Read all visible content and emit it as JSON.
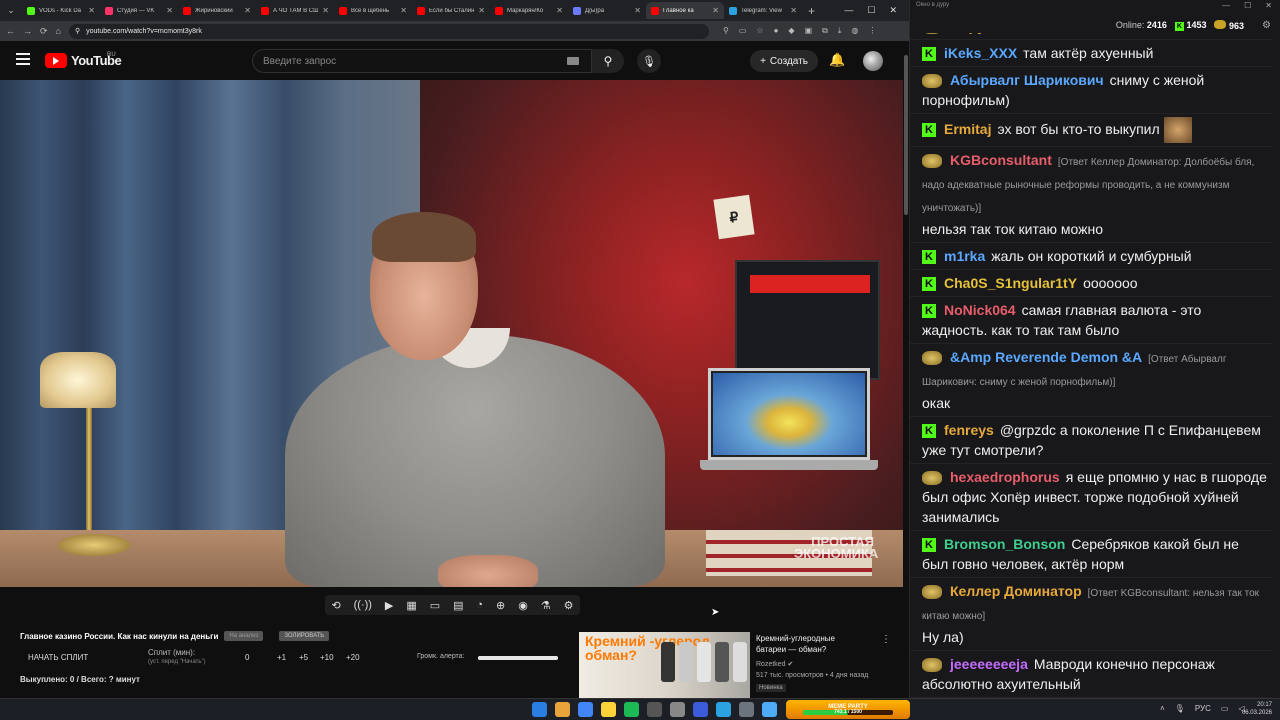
{
  "browser": {
    "tabs": [
      {
        "title": "VODs - Kick Da",
        "color": "#53fc18"
      },
      {
        "title": "Студия — VK",
        "color": "#ff3366"
      },
      {
        "title": "Жириновский",
        "color": "#ff0000"
      },
      {
        "title": "А ЧО ТАМ В СШ",
        "color": "#ff0000"
      },
      {
        "title": "Все в щебень",
        "color": "#ff0000"
      },
      {
        "title": "Если бы Сталин",
        "color": "#ff0000"
      },
      {
        "title": "Маркарян/Ко",
        "color": "#ff0000"
      },
      {
        "title": "Д(ы)ра",
        "color": "#6b7bff"
      },
      {
        "title": "Главное ка",
        "color": "#ff0000",
        "active": true
      },
      {
        "title": "Telegram: View",
        "color": "#2aa3e0"
      }
    ],
    "url": "youtube.com/watch?v=mcmomt3y8rk"
  },
  "youtube": {
    "logo": "YouTube",
    "region": "RU",
    "search_placeholder": "Введите запрос",
    "create_label": "Создать"
  },
  "video": {
    "paper_symbol": "₽",
    "watermark": "ПРОСТАЯ ЭКОНОМИКА"
  },
  "tools": [
    "⟲",
    "((·))",
    "▶",
    "▦",
    "▭",
    "▤",
    "◔",
    "⊕",
    "◉",
    "⚗",
    "⚙"
  ],
  "below": {
    "title": "Главное казино России. Как нас кинули на деньги",
    "tag1": "На анализ",
    "tag2": "ЗОЛИРОВАТЬ",
    "split_button": "НАЧАТЬ СПЛИТ",
    "split_label": "Сплит (мин):",
    "split_hint": "(уст. перед \"Начать\")",
    "split_values": [
      "0",
      "+1",
      "+5",
      "+10",
      "+20"
    ],
    "alert_volume_label": "Громк. алерта:",
    "alert_volume": 1.0,
    "bought": "Выкуплено: 0 / Всего: ? минут"
  },
  "recommended": {
    "thumb_text": "Кремний -углерод обман?",
    "title": "Кремний-углеродные батареи — обман?",
    "channel": "Rozetked",
    "meta": "517 тыс. просмотров • 4 дня назад",
    "badge": "Новинка"
  },
  "chat": {
    "window_title": "Окно в дуру",
    "online_label": "Online:",
    "online": "2416",
    "kick_count": "1453",
    "other_count": "963",
    "messages": [
      {
        "badge": "p",
        "user": "CopyPaste",
        "color": "#e6a93a",
        "reply": "",
        "text": "ген П имба"
      },
      {
        "badge": "k",
        "user": "iKeks_XXX",
        "color": "#5aa8ff",
        "reply": "",
        "text": "там актёр ахуенный"
      },
      {
        "badge": "p",
        "user": "Абырвалг Шарикович",
        "color": "#5aa8ff",
        "reply": "",
        "text": "сниму с женой порнофильм)"
      },
      {
        "badge": "k",
        "user": "Ermitaj",
        "color": "#e6a93a",
        "reply": "",
        "text": "эх вот бы кто-то выкупил",
        "emote": true
      },
      {
        "badge": "p",
        "user": "KGBconsultant",
        "color": "#e85d6a",
        "reply": "[Ответ Келлер Доминатор: Долбоёбы бля, надо адекватные рыночные реформы проводить, а не коммунизм уничтожать)]",
        "text": "нельзя так ток китаю можно"
      },
      {
        "badge": "k",
        "user": "m1rka",
        "color": "#5aa8ff",
        "reply": "",
        "text": "жаль он короткий и сумбурный"
      },
      {
        "badge": "k",
        "user": "Cha0S_S1ngular1tY",
        "color": "#e6c13a",
        "reply": "",
        "text": "ooooooo"
      },
      {
        "badge": "k",
        "user": "NoNick064",
        "color": "#e85d6a",
        "reply": "",
        "text": "самая главная валюта - это жадность. как то так там было"
      },
      {
        "badge": "p",
        "user": "&Amp Reverende Demon &A",
        "color": "#5aa8ff",
        "reply": "[Ответ Абырвалг Шарикович: сниму с женой порнофильм)]",
        "text": "окак"
      },
      {
        "badge": "k",
        "user": "fenreys",
        "color": "#e6a93a",
        "reply": "",
        "text": "@grpzdc а поколение П с Епифанцевем уже тут смотрели?"
      },
      {
        "badge": "p",
        "user": "hexaedrophorus",
        "color": "#e85d6a",
        "reply": "",
        "text": "я еще рпомню у нас в гшороде был офис Хопёр инвест. торже подобной хуйней занимались"
      },
      {
        "badge": "k",
        "user": "Bromson_Bonson",
        "color": "#3ecf8e",
        "reply": "",
        "text": "Серебряков какой был не был говно человек, актёр норм"
      },
      {
        "badge": "p",
        "user": "Келлер Доминатор",
        "color": "#e6a93a",
        "reply": "[Ответ KGBconsultant: нельзя так ток китаю можно]",
        "text": "Ну ла)"
      },
      {
        "badge": "p",
        "user": "jeeeeeeeeja",
        "color": "#c46cff",
        "reply": "",
        "text": "Мавроди конечно персонаж абсолютно ахуительный"
      }
    ]
  },
  "taskbar": {
    "meme_label": "MEME PARTY",
    "meme_progress_text": "743.1 / 1500",
    "meme_progress": 0.495,
    "lang": "РУС",
    "time": "20:17",
    "date": "06.03.2026",
    "app_colors": [
      "#2a7de1",
      "#e8a33b",
      "#4285f4",
      "#ffd43b",
      "#1db954",
      "#555",
      "#888",
      "#3b5bdb",
      "#2aa3e0",
      "#6c757d",
      "#4dabf7"
    ]
  }
}
